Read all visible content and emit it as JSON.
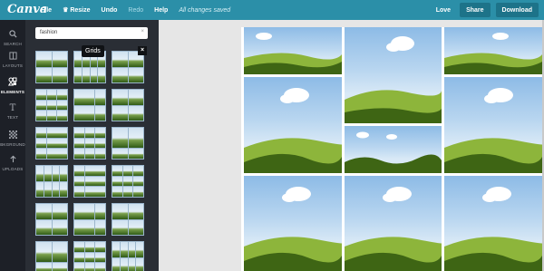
{
  "app": {
    "logo": "Canva",
    "menu": {
      "file": "File",
      "resize": "Resize",
      "undo": "Undo",
      "redo": "Redo",
      "help": "Help",
      "status": "All changes saved"
    },
    "right": {
      "love": "Love",
      "share": "Share",
      "download": "Download"
    }
  },
  "rail": [
    {
      "label": "SEARCH",
      "icon": "search-icon"
    },
    {
      "label": "LAYOUTS",
      "icon": "layouts-icon"
    },
    {
      "label": "ELEMENTS",
      "icon": "elements-icon"
    },
    {
      "label": "TEXT",
      "icon": "text-icon"
    },
    {
      "label": "BKGROUND",
      "icon": "background-icon"
    },
    {
      "label": "UPLOADS",
      "icon": "upload-icon"
    }
  ],
  "panel": {
    "search_value": "fashion",
    "tooltip": "Grids",
    "tooltip_close": "×",
    "clear": "×"
  },
  "colors": {
    "topbar": "#2b8fa8",
    "rail": "#1d2027",
    "panel": "#2a2e35",
    "grass_light": "#8db53b",
    "grass_dark": "#3e6514"
  }
}
